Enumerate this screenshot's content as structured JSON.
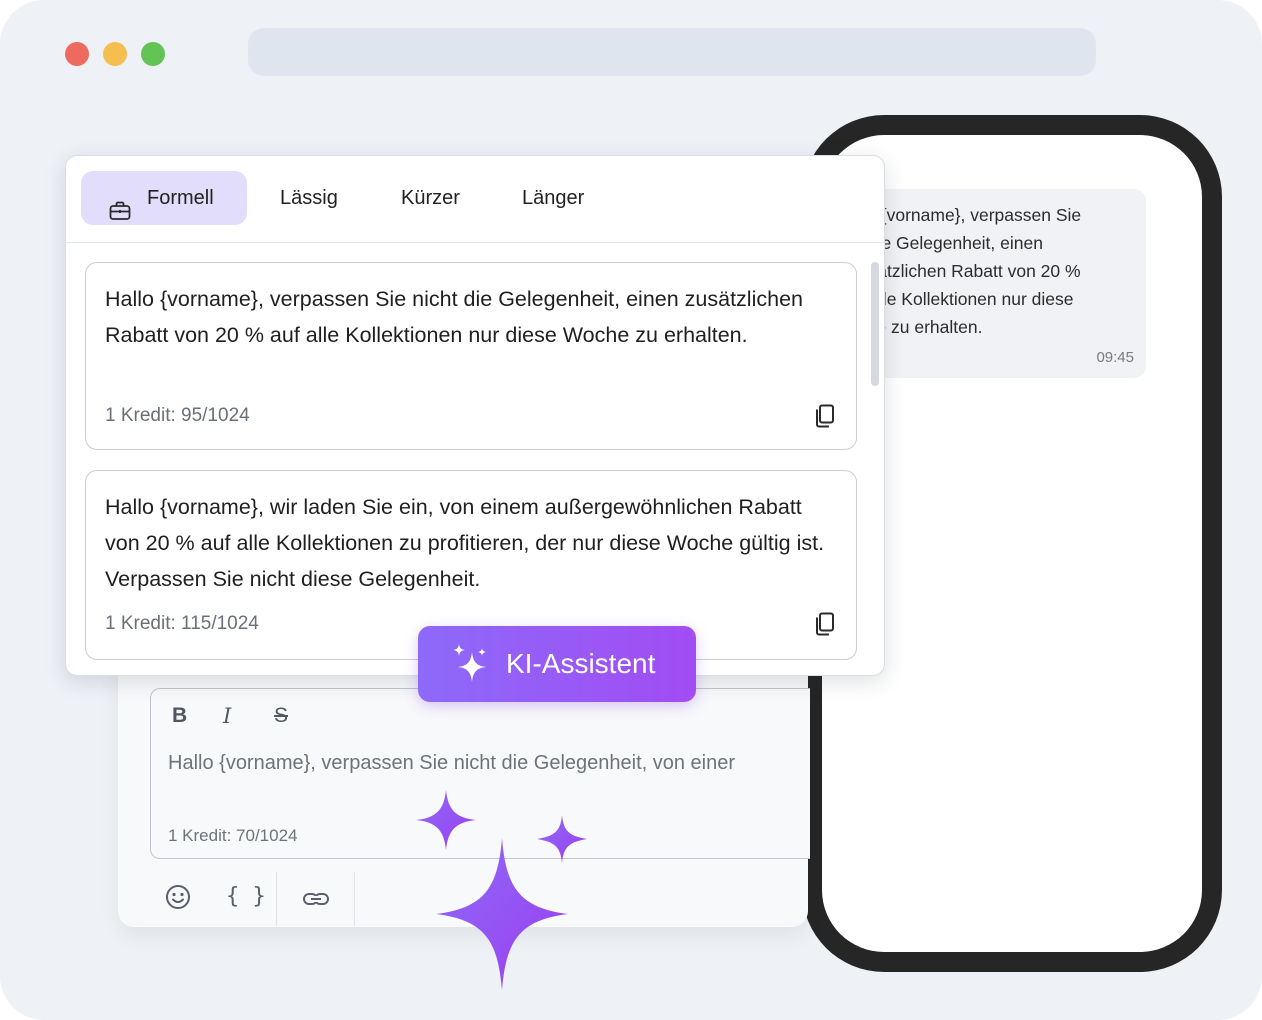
{
  "window": {
    "controls": [
      "close",
      "minimize",
      "maximize"
    ]
  },
  "tabs": [
    {
      "label": "Formell",
      "icon": "briefcase-icon",
      "active": true
    },
    {
      "label": "Lässig",
      "active": false
    },
    {
      "label": "Kürzer",
      "active": false
    },
    {
      "label": "Länger",
      "active": false
    }
  ],
  "suggestions": [
    {
      "text": "Hallo {vorname}, verpassen Sie nicht die Gelegenheit, einen zusätzlichen Rabatt von 20 % auf alle Kollektionen nur diese Woche zu erhalten.",
      "credit": "1 Kredit: 95/1024"
    },
    {
      "text": "Hallo {vorname}, wir laden Sie ein, von einem außergewöhnlichen Rabatt von 20 % auf alle Kollektionen zu profitieren, der nur diese Woche gültig ist. Verpassen Sie nicht diese Gelegenheit.",
      "credit": "1 Kredit: 115/1024"
    }
  ],
  "ai_button": {
    "label": "KI-Assistent",
    "icon": "sparkles-icon"
  },
  "editor": {
    "format_buttons": [
      "B",
      "I",
      "S"
    ],
    "text": "Hallo {vorname}, verpassen Sie nicht die Gelegenheit, von einer",
    "credit": "1 Kredit: 70/1024",
    "tools": [
      {
        "icon": "emoji-icon"
      },
      {
        "icon": "variable-braces-icon",
        "label": "{ }"
      },
      {
        "icon": "link-icon"
      }
    ]
  },
  "phone": {
    "message": {
      "lines": [
        "Hallo {vorname}, verpassen Sie",
        "nicht die Gelegenheit, einen",
        "zusätzlichen Rabatt von 20 %",
        "auf alle Kollektionen nur diese",
        "Woche zu erhalten."
      ],
      "time": "09:45"
    }
  },
  "colors": {
    "accent": "#8d6af9",
    "accent_end": "#a24cf3",
    "active_tab": "#e2ddfb",
    "phone_frame": "#262626"
  }
}
